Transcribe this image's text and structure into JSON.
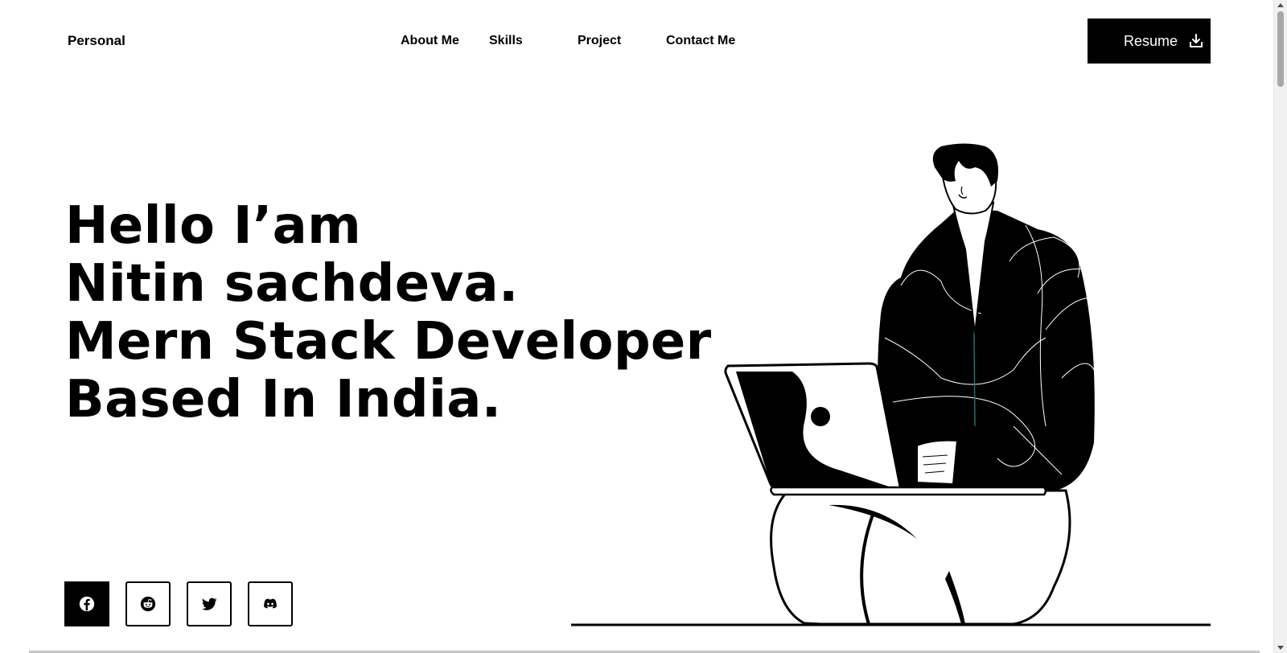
{
  "header": {
    "brand": "Personal",
    "nav": [
      "About Me",
      "Skills",
      "Project",
      "Contact Me"
    ],
    "resume_label": "Resume",
    "resume_icon": "download-icon"
  },
  "hero": {
    "lines": [
      "Hello I’am",
      "Nitin sachdeva.",
      "Mern Stack Developer",
      "Based In India."
    ]
  },
  "socials": [
    {
      "name": "facebook",
      "icon": "facebook-icon",
      "active": true
    },
    {
      "name": "reddit",
      "icon": "reddit-icon",
      "active": false
    },
    {
      "name": "twitter",
      "icon": "twitter-icon",
      "active": false
    },
    {
      "name": "discord",
      "icon": "discord-icon",
      "active": false
    }
  ],
  "colors": {
    "primary": "#000000",
    "background": "#ffffff",
    "accent_line": "#1f6f6a"
  }
}
